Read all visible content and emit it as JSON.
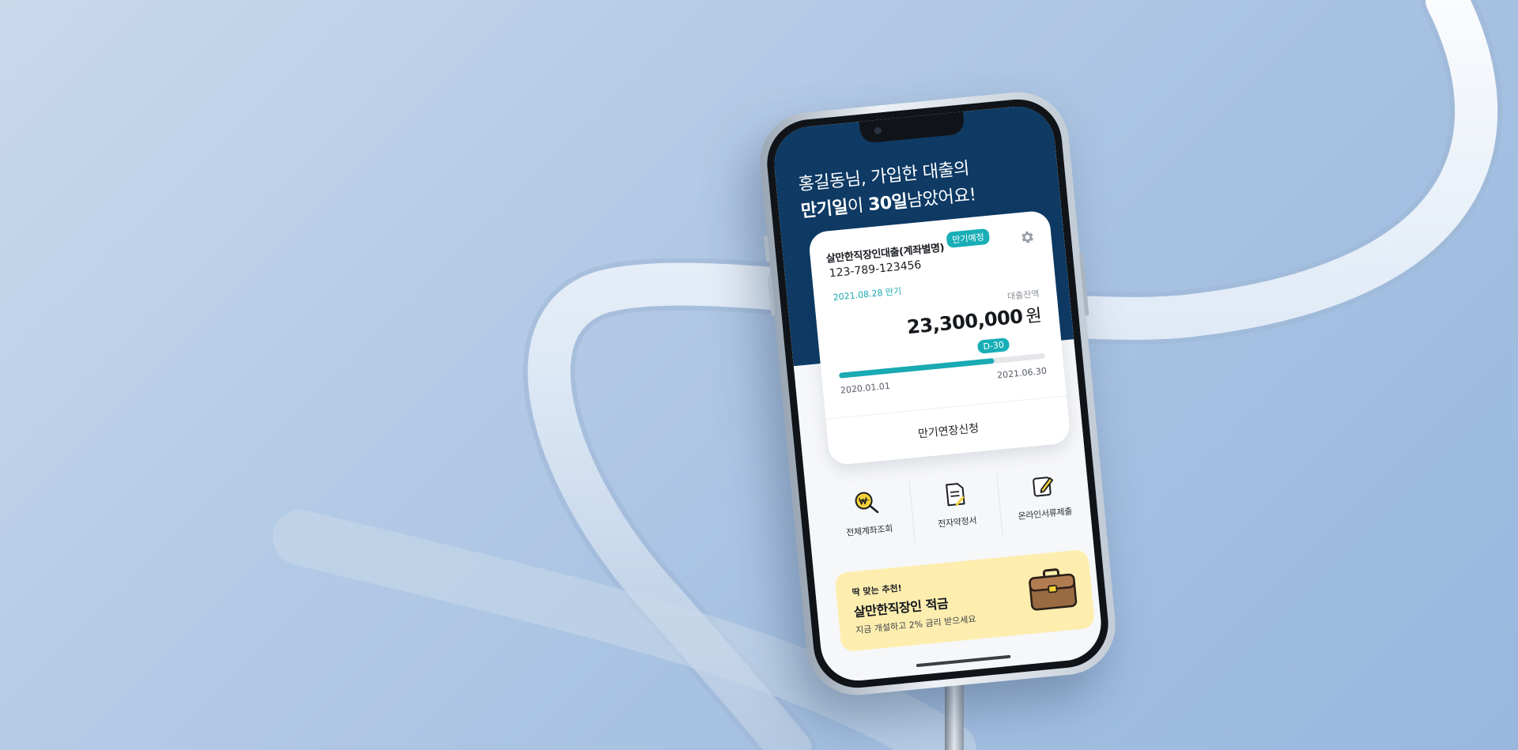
{
  "greeting": {
    "line1": "홍길동님, 가입한 대출의",
    "line2_bold": "만기일",
    "line2_a": "이 ",
    "line2_highlight": "30일",
    "line2_b": "남았어요!"
  },
  "loan_card": {
    "name": "살만한직장인대출(계좌별명)",
    "status_badge": "만기예정",
    "account_number": "123-789-123456",
    "due_date": "2021.08.28 만기",
    "balance_label": "대출잔액",
    "balance": "23,300,000",
    "balance_unit": "원",
    "dday": "D-30",
    "progress": 0.75,
    "start_date": "2020.01.01",
    "end_date": "2021.06.30",
    "extend_label": "만기연장신청"
  },
  "quick_menu": [
    {
      "label": "전체계좌조회",
      "icon": "won-search-icon"
    },
    {
      "label": "전자약정서",
      "icon": "document-icon"
    },
    {
      "label": "온라인서류제출",
      "icon": "edit-document-icon"
    }
  ],
  "promo": {
    "tag": "딱 맞는 추천!",
    "title": "살만한직장인 적금",
    "description": "지금 개설하고 2% 금리 받으세요",
    "icon": "briefcase-icon"
  },
  "colors": {
    "navy": "#0e3a64",
    "teal": "#18aeb6",
    "promo_bg": "#fdeeb0",
    "icon_yellow": "#f5d23a"
  }
}
